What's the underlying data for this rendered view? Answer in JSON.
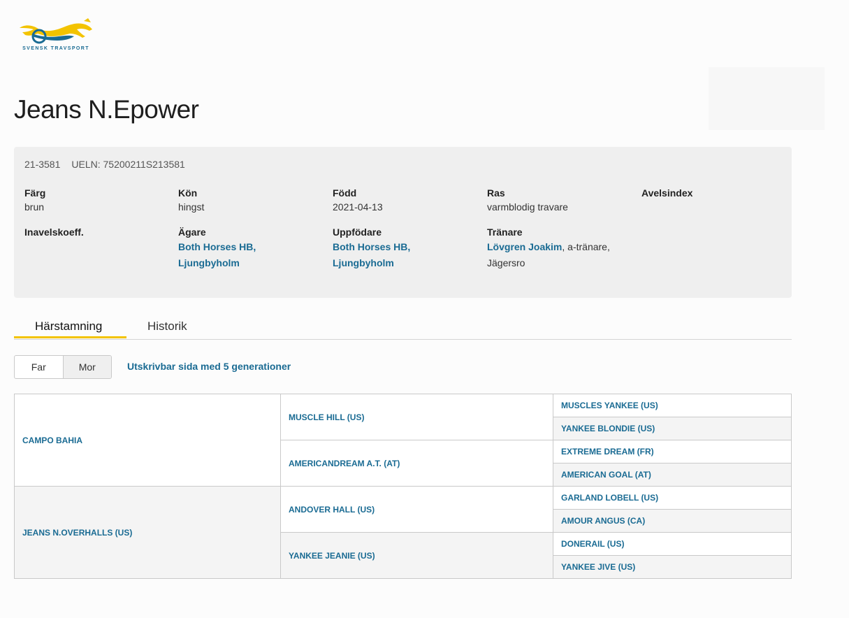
{
  "logo": {
    "text": "SVENSK TRAVSPORT",
    "icon": "trotting-horse-logo",
    "colors": {
      "primary": "#1a6b93",
      "accent": "#f3c300"
    }
  },
  "horse": {
    "name": "Jeans N.Epower",
    "reg_no": "21-3581",
    "ueln": "UELN: 75200211S213581"
  },
  "details": {
    "farg": {
      "label": "Färg",
      "value": "brun"
    },
    "kon": {
      "label": "Kön",
      "value": "hingst"
    },
    "fodd": {
      "label": "Född",
      "value": "2021-04-13"
    },
    "ras": {
      "label": "Ras",
      "value": "varmblodig travare"
    },
    "avelsindex": {
      "label": "Avelsindex"
    },
    "inavel": {
      "label": "Inavelskoeff."
    },
    "agare": {
      "label": "Ägare",
      "line1": "Both Horses HB,",
      "line2": "Ljungbyholm"
    },
    "uppfodare": {
      "label": "Uppfödare",
      "line1": "Both Horses HB,",
      "line2": "Ljungbyholm"
    },
    "tranare": {
      "label": "Tränare",
      "name": "Lövgren Joakim",
      "suffix": ", a-tränare,",
      "line2": "Jägersro"
    }
  },
  "tabs": [
    {
      "label": "Härstamning",
      "active": true
    },
    {
      "label": "Historik",
      "active": false
    }
  ],
  "toggle": {
    "far": "Far",
    "mor": "Mor"
  },
  "print_link": "Utskrivbar sida med 5 generationer",
  "pedigree": {
    "gen1": [
      "CAMPO BAHIA",
      "JEANS N.OVERHALLS (US)"
    ],
    "gen2": [
      "MUSCLE HILL (US)",
      "AMERICANDREAM A.T. (AT)",
      "ANDOVER HALL (US)",
      "YANKEE JEANIE (US)"
    ],
    "gen3": [
      "MUSCLES YANKEE (US)",
      "YANKEE BLONDIE (US)",
      "EXTREME DREAM (FR)",
      "AMERICAN GOAL (AT)",
      "GARLAND LOBELL (US)",
      "AMOUR ANGUS (CA)",
      "DONERAIL (US)",
      "YANKEE JIVE (US)"
    ]
  }
}
